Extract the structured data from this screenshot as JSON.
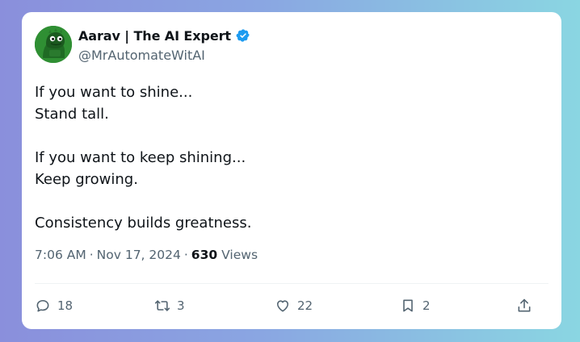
{
  "author": {
    "name": "Aarav | The AI Expert",
    "handle": "@MrAutomateWitAI",
    "verified": true,
    "verified_color": "#1d9bf0"
  },
  "tweet": {
    "lines": [
      "If you want to shine...",
      "Stand tall.",
      "If you want to keep shining...",
      "Keep growing.",
      "Consistency builds greatness."
    ]
  },
  "meta": {
    "time": "7:06 AM",
    "separator": "·",
    "date": "Nov 17, 2024",
    "views_count": "630",
    "views_label": "Views"
  },
  "actions": {
    "reply": {
      "icon": "reply-icon",
      "count": "18"
    },
    "retweet": {
      "icon": "retweet-icon",
      "count": "3"
    },
    "like": {
      "icon": "heart-icon",
      "count": "22"
    },
    "bookmark": {
      "icon": "bookmark-icon",
      "count": "2"
    },
    "share": {
      "icon": "share-icon"
    }
  },
  "colors": {
    "text_primary": "#0f1419",
    "text_secondary": "#536471",
    "avatar_bg": "#2a8a2e"
  }
}
